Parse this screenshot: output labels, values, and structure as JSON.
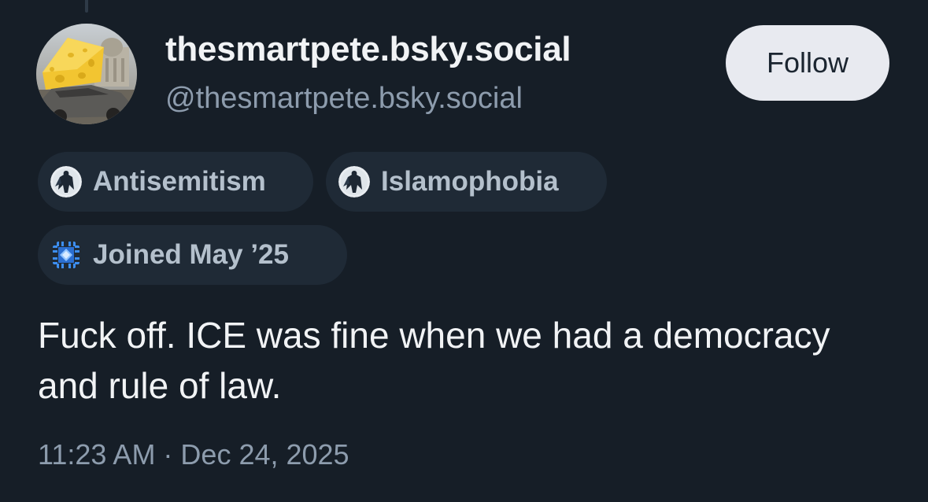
{
  "post": {
    "author": {
      "display_name": "thesmartpete.bsky.social",
      "handle": "@thesmartpete.bsky.social",
      "avatar_icon": "cheese-on-wrecked-car-avatar"
    },
    "follow_label": "Follow",
    "labels": [
      {
        "text": "Antisemitism",
        "icon": "caped-figure-icon"
      },
      {
        "text": "Islamophobia",
        "icon": "caped-figure-icon"
      },
      {
        "text": "Joined May ’25",
        "icon": "blue-grid-badge-icon"
      }
    ],
    "text": "Fuck off.  ICE was fine when we had a democracy and rule of law.",
    "timestamp": "11:23 AM · Dec 24, 2025"
  },
  "colors": {
    "background": "#161e27",
    "pill_background": "#1f2a36",
    "secondary_text": "#8d9cad",
    "follow_button": "#e8eaf0"
  }
}
